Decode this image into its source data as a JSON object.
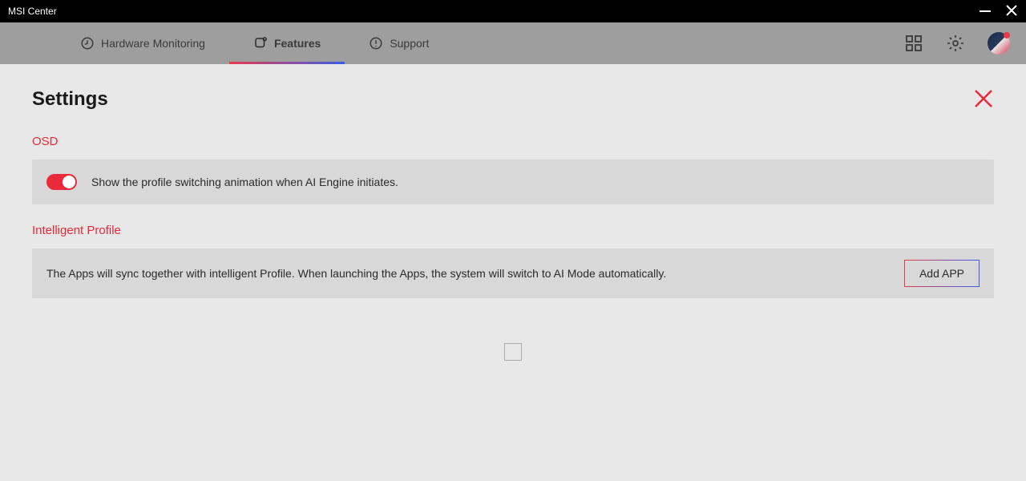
{
  "window": {
    "title": "MSI Center"
  },
  "nav": {
    "tabs": [
      {
        "label": "Hardware Monitoring"
      },
      {
        "label": "Features"
      },
      {
        "label": "Support"
      }
    ]
  },
  "page": {
    "title": "Settings"
  },
  "sections": {
    "osd": {
      "label": "OSD",
      "toggle_text": "Show the profile switching animation when AI Engine initiates."
    },
    "intelligent_profile": {
      "label": "Intelligent Profile",
      "description": "The Apps will sync together with intelligent Profile. When launching the Apps, the system will switch to AI Mode automatically.",
      "add_button": "Add APP"
    }
  },
  "colors": {
    "accent_red": "#ea2a3a",
    "accent_blue": "#3a5ee8"
  }
}
